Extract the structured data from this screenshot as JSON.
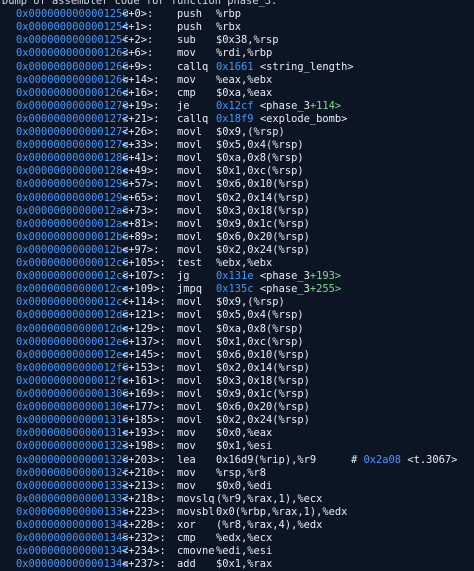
{
  "header": "Dump of assembler code for function phase_3:",
  "lines": [
    {
      "addr": "0x0000000000001250",
      "off": "<+0>:",
      "mn": "push",
      "ops": "%rbp"
    },
    {
      "addr": "0x0000000000001254",
      "off": "<+1>:",
      "mn": "push",
      "ops": "%rbx"
    },
    {
      "addr": "0x000000000000125f",
      "off": "<+2>:",
      "mn": "sub",
      "ops": "$0x38,%rsp"
    },
    {
      "addr": "0x0000000000001263",
      "off": "<+6>:",
      "mn": "mov",
      "ops": "%rdi,%rbp"
    },
    {
      "addr": "0x0000000000001266",
      "off": "<+9>:",
      "mn": "callq",
      "target": "0x1661",
      "sym": "<string_length>",
      "symOff": ""
    },
    {
      "addr": "0x000000000000126b",
      "off": "<+14>:",
      "mn": "mov",
      "ops": "%eax,%ebx"
    },
    {
      "addr": "0x000000000000126d",
      "off": "<+16>:",
      "mn": "cmp",
      "ops": "$0xa,%eax"
    },
    {
      "addr": "0x0000000000001270",
      "off": "<+19>:",
      "mn": "je",
      "target": "0x12cf",
      "sym": "<phase_3",
      "symOff": "+114>"
    },
    {
      "addr": "0x0000000000001272",
      "off": "<+21>:",
      "mn": "callq",
      "target": "0x18f9",
      "sym": "<explode_bomb>",
      "symOff": ""
    },
    {
      "addr": "0x0000000000001277",
      "off": "<+26>:",
      "mn": "movl",
      "ops": "$0x9,(%rsp)"
    },
    {
      "addr": "0x000000000000127e",
      "off": "<+33>:",
      "mn": "movl",
      "ops": "$0x5,0x4(%rsp)"
    },
    {
      "addr": "0x0000000000001286",
      "off": "<+41>:",
      "mn": "movl",
      "ops": "$0xa,0x8(%rsp)"
    },
    {
      "addr": "0x000000000000128e",
      "off": "<+49>:",
      "mn": "movl",
      "ops": "$0x1,0xc(%rsp)"
    },
    {
      "addr": "0x0000000000001296",
      "off": "<+57>:",
      "mn": "movl",
      "ops": "$0x6,0x10(%rsp)"
    },
    {
      "addr": "0x000000000000129e",
      "off": "<+65>:",
      "mn": "movl",
      "ops": "$0x2,0x14(%rsp)"
    },
    {
      "addr": "0x00000000000012a6",
      "off": "<+73>:",
      "mn": "movl",
      "ops": "$0x3,0x18(%rsp)"
    },
    {
      "addr": "0x00000000000012ae",
      "off": "<+81>:",
      "mn": "movl",
      "ops": "$0x9,0x1c(%rsp)"
    },
    {
      "addr": "0x00000000000012b6",
      "off": "<+89>:",
      "mn": "movl",
      "ops": "$0x6,0x20(%rsp)"
    },
    {
      "addr": "0x00000000000012be",
      "off": "<+97>:",
      "mn": "movl",
      "ops": "$0x2,0x24(%rsp)"
    },
    {
      "addr": "0x00000000000012c6",
      "off": "<+105>:",
      "mn": "test",
      "ops": "%ebx,%ebx"
    },
    {
      "addr": "0x00000000000012c8",
      "off": "<+107>:",
      "mn": "jg",
      "target": "0x131e",
      "sym": "<phase_3",
      "symOff": "+193>"
    },
    {
      "addr": "0x00000000000012ca",
      "off": "<+109>:",
      "mn": "jmpq",
      "target": "0x135c",
      "sym": "<phase_3",
      "symOff": "+255>"
    },
    {
      "addr": "0x00000000000012cf",
      "off": "<+114>:",
      "mn": "movl",
      "ops": "$0x9,(%rsp)"
    },
    {
      "addr": "0x00000000000012d6",
      "off": "<+121>:",
      "mn": "movl",
      "ops": "$0x5,0x4(%rsp)"
    },
    {
      "addr": "0x00000000000012de",
      "off": "<+129>:",
      "mn": "movl",
      "ops": "$0xa,0x8(%rsp)"
    },
    {
      "addr": "0x00000000000012e6",
      "off": "<+137>:",
      "mn": "movl",
      "ops": "$0x1,0xc(%rsp)"
    },
    {
      "addr": "0x00000000000012ee",
      "off": "<+145>:",
      "mn": "movl",
      "ops": "$0x6,0x10(%rsp)"
    },
    {
      "addr": "0x00000000000012f6",
      "off": "<+153>:",
      "mn": "movl",
      "ops": "$0x2,0x14(%rsp)"
    },
    {
      "addr": "0x00000000000012fe",
      "off": "<+161>:",
      "mn": "movl",
      "ops": "$0x3,0x18(%rsp)"
    },
    {
      "addr": "0x0000000000001306",
      "off": "<+169>:",
      "mn": "movl",
      "ops": "$0x9,0x1c(%rsp)"
    },
    {
      "addr": "0x000000000000130e",
      "off": "<+177>:",
      "mn": "movl",
      "ops": "$0x6,0x20(%rsp)"
    },
    {
      "addr": "0x0000000000001316",
      "off": "<+185>:",
      "mn": "movl",
      "ops": "$0x2,0x24(%rsp)"
    },
    {
      "addr": "0x000000000000131e",
      "off": "<+193>:",
      "mn": "mov",
      "ops": "$0x0,%eax"
    },
    {
      "addr": "0x0000000000001323",
      "off": "<+198>:",
      "mn": "mov",
      "ops": "$0x1,%esi"
    },
    {
      "addr": "0x0000000000001328",
      "off": "<+203>:",
      "mn": "lea",
      "ops": "0x16d9(%rip),%r9",
      "cHash": "#",
      "cAddr": "0x2a08",
      "cSym": "<t.3067>"
    },
    {
      "addr": "0x000000000000132f",
      "off": "<+210>:",
      "mn": "mov",
      "ops": "%rsp,%r8"
    },
    {
      "addr": "0x0000000000001332",
      "off": "<+213>:",
      "mn": "mov",
      "ops": "$0x0,%edi"
    },
    {
      "addr": "0x0000000000001337",
      "off": "<+218>:",
      "mn": "movslq",
      "ops": "(%r9,%rax,1),%ecx"
    },
    {
      "addr": "0x000000000000133b",
      "off": "<+223>:",
      "mn": "movsbl",
      "ops": "0x0(%rbp,%rax,1),%edx"
    },
    {
      "addr": "0x0000000000001341",
      "off": "<+228>:",
      "mn": "xor",
      "ops": "(%r8,%rax,4),%edx"
    },
    {
      "addr": "0x0000000000001345",
      "off": "<+232>:",
      "mn": "cmp",
      "ops": "%edx,%ecx"
    },
    {
      "addr": "0x0000000000001347",
      "off": "<+234>:",
      "mn": "cmovne",
      "ops": "%edi,%esi"
    },
    {
      "addr": "0x000000000000134a",
      "off": "<+237>:",
      "mn": "add",
      "ops": "$0x1,%rax"
    }
  ]
}
